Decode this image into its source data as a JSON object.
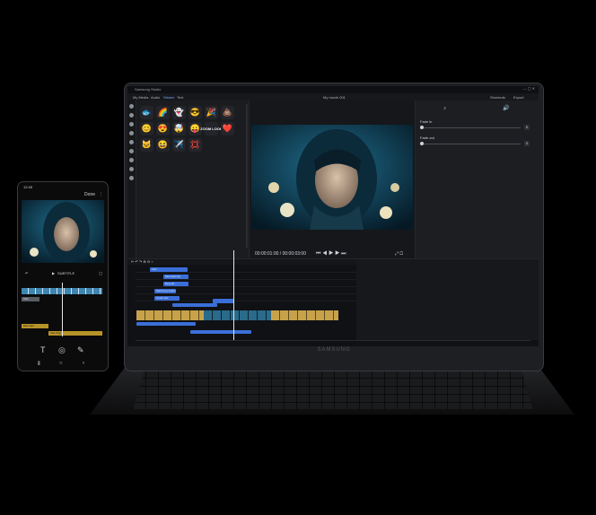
{
  "laptop": {
    "window_title": "Samsung Studio",
    "menu": [
      "My Media",
      "Audio",
      "Sticker",
      "Text"
    ],
    "active_menu_index": 2,
    "project_title": "My movie 001",
    "top_right": {
      "shortcuts": "Shortcuts",
      "export": "Export"
    },
    "brand": "SAMSUNG",
    "stickers": [
      "🐟",
      "🌈",
      "👻",
      "😎",
      "🎉",
      "💩",
      "😊",
      "😍",
      "🤯",
      "😛",
      "ZOOM LOOK",
      "❤️",
      "🐱",
      "😆",
      "✈️",
      "💢"
    ],
    "fade_in_label": "Fade in",
    "fade_out_label": "Fade out",
    "fade_in_value": "0",
    "fade_out_value": "0",
    "timecode": "00:00:01:00 / 00:00:03:00",
    "tracks": [
      {
        "label": "Intro"
      },
      {
        "label": "Mermaid city"
      },
      {
        "label": "Beyond"
      },
      {
        "label": "Samsung studio"
      },
      {
        "label": "Coral reef"
      }
    ],
    "colors": {
      "accent": "#3b6fd8",
      "active_menu": "#7aa7ff"
    }
  },
  "phone": {
    "time": "12:45",
    "done": "Done",
    "subtitle_label": "SUBTITLE",
    "tracks": [
      "Intro",
      "Mermaid",
      "Sea drop"
    ],
    "nav": [
      "T",
      "◎",
      "✎"
    ]
  }
}
